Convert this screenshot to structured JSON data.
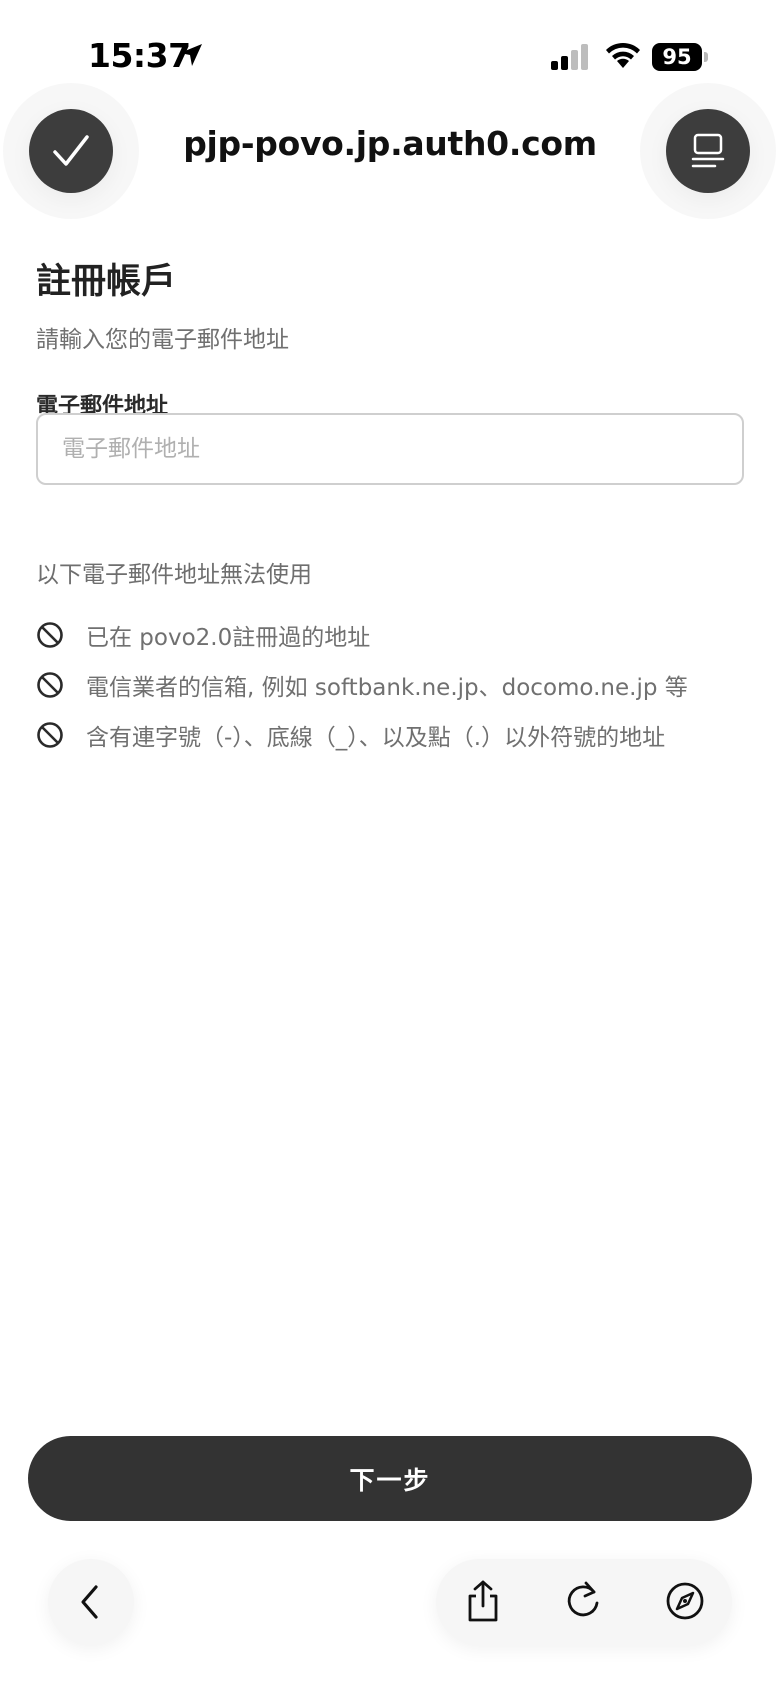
{
  "status_bar": {
    "time": "15:37",
    "battery": "95"
  },
  "browser": {
    "url": "pjp-povo.jp.auth0.com"
  },
  "form": {
    "title": "註冊帳戶",
    "subtitle": "請輸入您的電子郵件地址",
    "email_label": "電子郵件地址",
    "email_placeholder": "電子郵件地址",
    "email_value": "",
    "notice_heading": "以下電子郵件地址無法使用",
    "restrictions": [
      "已在 povo2.0註冊過的地址",
      "電信業者的信箱, 例如 softbank.ne.jp、docomo.ne.jp 等",
      "含有連字號（-）、底線（_）、以及點（.）以外符號的地址"
    ],
    "next_label": "下一步"
  },
  "colors": {
    "primary_button": "#333333",
    "icon_circle": "#3d3d3d",
    "muted_text": "#707070"
  },
  "icons": {
    "done": "checkmark-icon",
    "tabs": "tabs-icon",
    "back": "chevron-left-icon",
    "share": "share-icon",
    "reload": "reload-icon",
    "compass": "compass-icon",
    "restriction": "prohibited-icon"
  }
}
